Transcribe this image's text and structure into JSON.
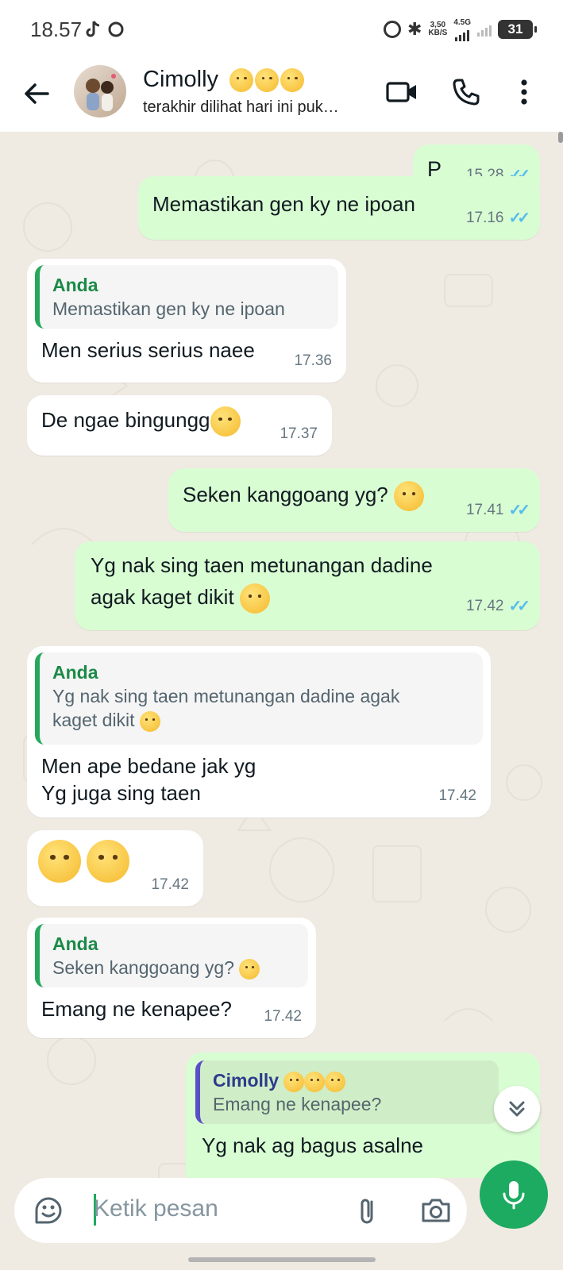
{
  "status_bar": {
    "time": "18.57",
    "net_speed_value": "3,50",
    "net_speed_unit": "KB/S",
    "network": "4.5G",
    "battery": "31"
  },
  "header": {
    "contact_name": "Cimolly",
    "contact_status": "terakhir dilihat hari ini puk…"
  },
  "messages": [
    {
      "direction": "out",
      "text": "P",
      "time": "15.28",
      "read": true
    },
    {
      "direction": "out",
      "text": "Memastikan gen ky ne ipoan",
      "time": "17.16",
      "read": true
    },
    {
      "direction": "in",
      "quote_author": "Anda",
      "quote_text": "Memastikan gen ky ne ipoan",
      "text": "Men serius serius naee",
      "time": "17.36"
    },
    {
      "direction": "in",
      "text": "De ngae bingungg",
      "time": "17.37"
    },
    {
      "direction": "out",
      "text": "Seken kanggoang yg?",
      "time": "17.41",
      "read": true
    },
    {
      "direction": "out",
      "text_line1": "Yg nak sing taen metunangan dadine",
      "text_line2": "agak kaget dikit",
      "time": "17.42",
      "read": true
    },
    {
      "direction": "in",
      "quote_author": "Anda",
      "quote_text_line1": "Yg nak sing taen metunangan dadine agak",
      "quote_text_line2": "kaget dikit",
      "text_line1": "Men ape bedane jak yg",
      "text_line2": "Yg juga sing taen",
      "time": "17.42"
    },
    {
      "direction": "in",
      "text": "",
      "time": "17.42"
    },
    {
      "direction": "in",
      "quote_author": "Anda",
      "quote_text": "Seken kanggoang yg?",
      "text": "Emang ne kenapee?",
      "time": "17.42"
    },
    {
      "direction": "out",
      "quote_author": "Cimolly",
      "quote_text": "Emang ne kenapee?",
      "text": "Yg nak ag bagus asalne"
    }
  ],
  "composer": {
    "placeholder": "Ketik pesan"
  },
  "colors": {
    "outgoing_bubble": "#d9fdd3",
    "incoming_bubble": "#ffffff",
    "chat_background": "#efeae2",
    "read_ticks": "#53bdeb",
    "accent_green": "#1daa61"
  },
  "icons": [
    "back-arrow-icon",
    "video-call-icon",
    "phone-icon",
    "more-vert-icon",
    "sticker-icon",
    "attach-icon",
    "camera-icon",
    "mic-icon",
    "chevron-down-icon"
  ]
}
